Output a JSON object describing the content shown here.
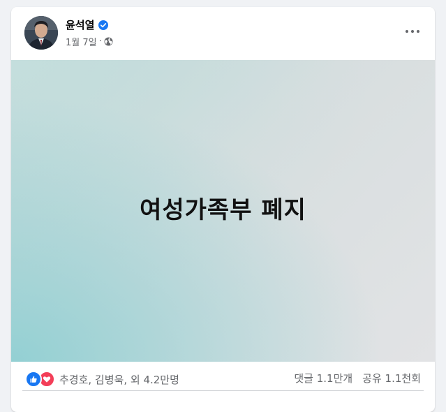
{
  "post": {
    "author": "윤석열",
    "verified": true,
    "date": "1월 7일",
    "separator": "·",
    "privacy_icon": "globe-icon",
    "image_text": "여성가족부 폐지",
    "reactions": {
      "icons": [
        "like-icon",
        "love-icon"
      ],
      "summary": "추경호, 김병욱, 외 4.2만명"
    },
    "comments": "댓글 1.1만개",
    "shares": "공유 1.1천회"
  },
  "colors": {
    "facebook_blue": "#1877f2",
    "love_red": "#f33e58",
    "secondary_text": "#65676b"
  }
}
